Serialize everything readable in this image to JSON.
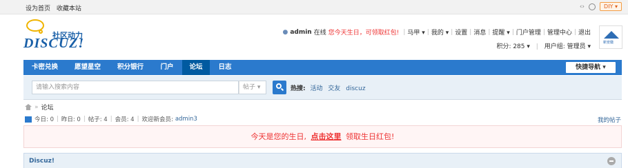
{
  "topbar": {
    "set_home": "设为首页",
    "favorite": "收藏本站",
    "diy_label": "DIY"
  },
  "logo": {
    "tagline": "社区动力",
    "brand": "DISCUZ!"
  },
  "user": {
    "name": "admin",
    "status": "在线",
    "birthday_link": "您今天生日，可领取红包!",
    "menu": [
      "马甲",
      "我的",
      "设置",
      "消息",
      "提醒",
      "门户管理",
      "管理中心",
      "退出"
    ],
    "points": "积分: 285",
    "group": "用户组: 管理员",
    "avatar_text": "新安徽"
  },
  "nav": {
    "items": [
      "卡密兑换",
      "愿望星空",
      "积分银行",
      "门户",
      "论坛",
      "日志"
    ],
    "active_index": 4,
    "quick_nav": "快捷导航"
  },
  "search": {
    "placeholder": "请输入搜索内容",
    "type": "帖子",
    "hot_label": "热搜:",
    "hot_keywords": [
      "活动",
      "交友",
      "discuz"
    ]
  },
  "breadcrumb": {
    "arrow": "»",
    "current": "论坛"
  },
  "stats": {
    "today": "今日: 0",
    "yesterday": "昨日: 0",
    "posts": "帖子: 4",
    "members": "会员: 4",
    "welcome": "欢迎新会员:",
    "new_member": "admin3",
    "my_posts": "我的帖子"
  },
  "notice": {
    "before": "今天是您的生日,",
    "link": "点击这里",
    "after": "领取生日红包!"
  },
  "forum": {
    "title": "Discuz!"
  },
  "colors": {
    "nav_bg": "#2b7acd",
    "nav_active": "#005aa0",
    "alert_red": "#e33",
    "link_blue": "#336699"
  }
}
